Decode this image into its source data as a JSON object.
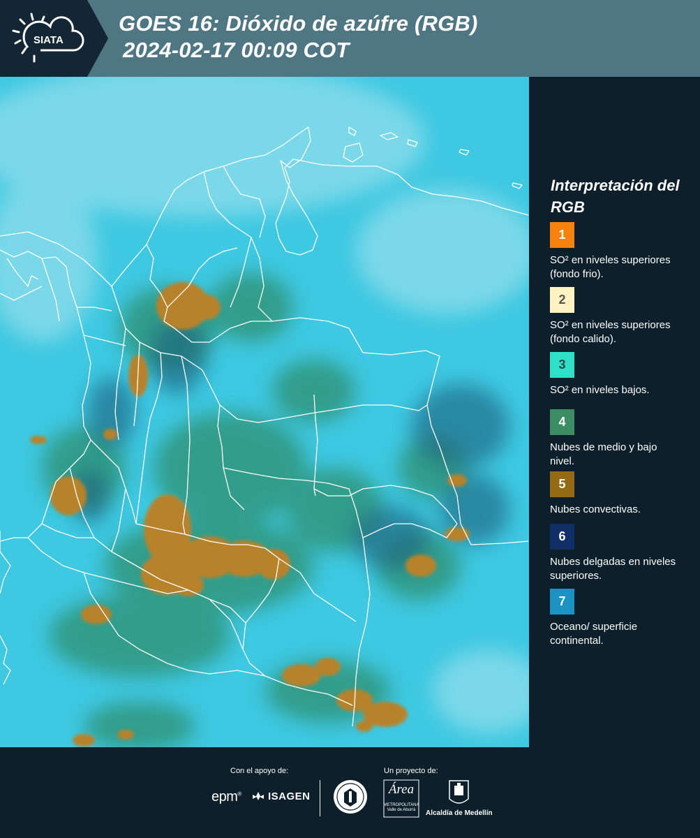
{
  "header": {
    "logo_text": "SIATA",
    "title": "GOES 16: Dióxido de azúfre (RGB)",
    "timestamp": "2024-02-17 00:09 COT"
  },
  "map": {
    "colors": {
      "background": "#3ec8e2",
      "ocean_haze": "#7ad8e8",
      "low_cloud": "#2f8f6e",
      "convective": "#b8822a",
      "thin_high": "#1f5f7a",
      "borders": "#ffffff"
    }
  },
  "legend": {
    "title": "Interpretación del RGB",
    "items": [
      {
        "number": "1",
        "color": "#f7820e",
        "number_color": "#ffffff",
        "text": "SO² en niveles superiores (fondo frio)."
      },
      {
        "number": "2",
        "color": "#fff3c4",
        "number_color": "#555555",
        "text": "SO² en niveles superiores (fondo calido)."
      },
      {
        "number": "3",
        "color": "#2de0c6",
        "number_color": "#2b4a4a",
        "text": "SO² en niveles bajos."
      },
      {
        "number": "4",
        "color": "#3c8c64",
        "number_color": "#ffffff",
        "text": "Nubes de medio y bajo nivel."
      },
      {
        "number": "5",
        "color": "#946a14",
        "number_color": "#ffffff",
        "text": "Nubes convectivas."
      },
      {
        "number": "6",
        "color": "#0f2f66",
        "number_color": "#ffffff",
        "text": "Nubes delgadas en niveles superiores."
      },
      {
        "number": "7",
        "color": "#1b94c4",
        "number_color": "#ffffff",
        "text": "Oceano/ superficie continental."
      }
    ]
  },
  "footer": {
    "support_caption": "Con el apoyo de:",
    "project_caption": "Un proyecto de:",
    "sponsors": [
      "epm",
      "ISAGEN"
    ],
    "partners": [
      "Área Metropolitana Valle de Aburrá",
      "Alcaldía de Medellín"
    ],
    "epm_text": "epm",
    "isagen_text": "ISAGEN",
    "area_text": "Área",
    "area_subtext": "METROPOLITANA Valle de Aburrá",
    "alcaldia_text": "Alcaldía de Medellín"
  }
}
